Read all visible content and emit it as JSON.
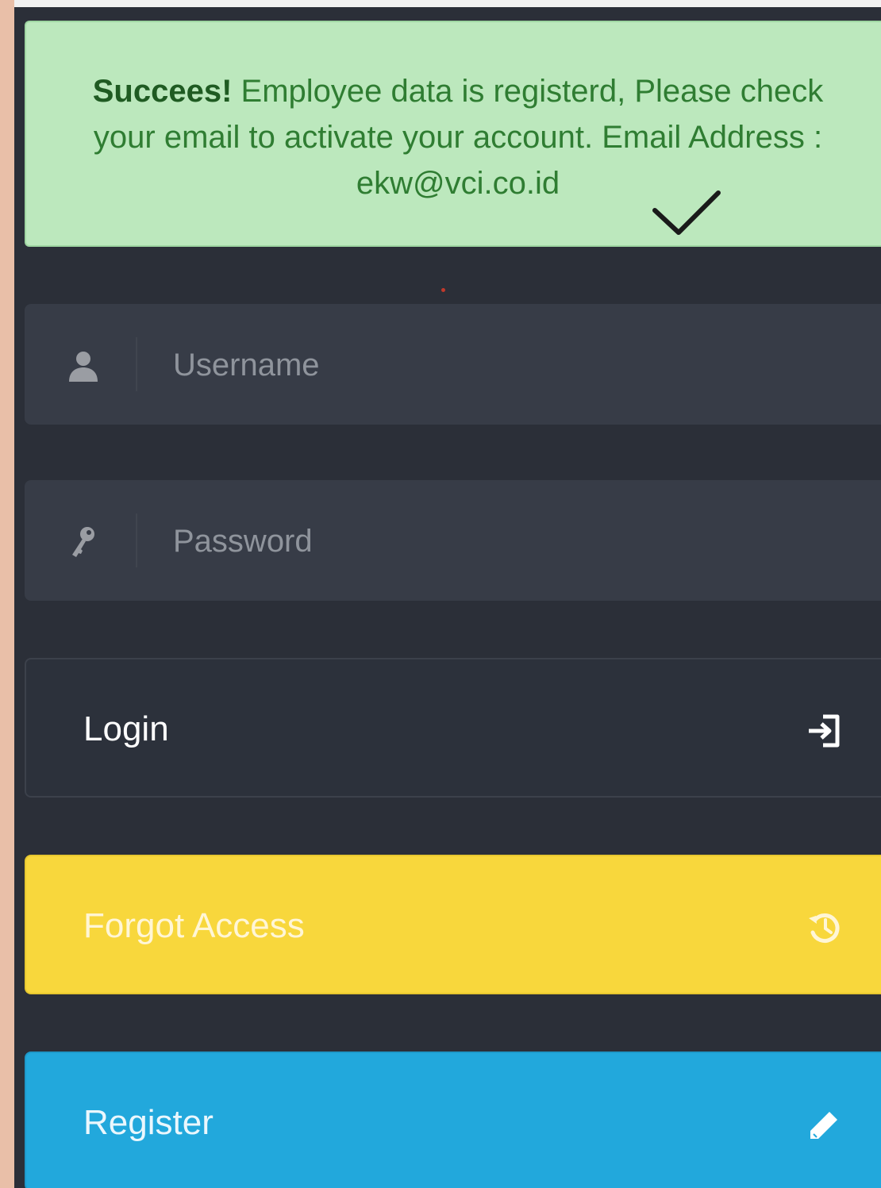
{
  "alert": {
    "strong": "Succees!",
    "message": " Employee data is registerd, Please check your email to activate your account. Email Address :",
    "email": "ekw@vci.co.id",
    "bg_color": "#bce8bd",
    "text_color": "#2f7d32"
  },
  "form": {
    "username": {
      "placeholder": "Username",
      "icon": "user-icon"
    },
    "password": {
      "placeholder": "Password",
      "icon": "key-icon"
    }
  },
  "buttons": {
    "login": {
      "label": "Login",
      "icon": "sign-in-icon",
      "color": "#2c313b"
    },
    "forgot": {
      "label": "Forgot Access",
      "icon": "history-icon",
      "color": "#f8d73c"
    },
    "register": {
      "label": "Register",
      "icon": "pencil-icon",
      "color": "#22a8dc"
    }
  }
}
